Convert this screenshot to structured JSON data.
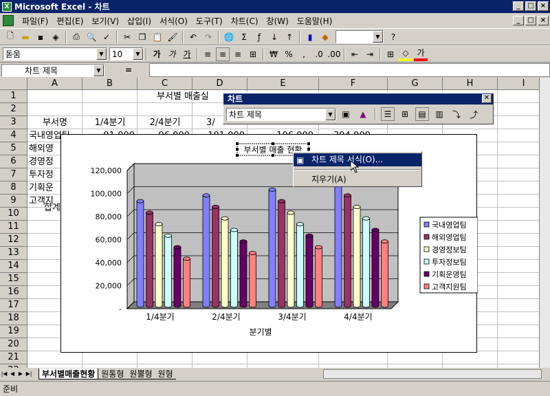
{
  "window": {
    "app_title": "Microsoft Excel - 차트"
  },
  "menu": [
    "파일(F)",
    "편집(E)",
    "보기(V)",
    "삽입(I)",
    "서식(O)",
    "도구(T)",
    "차트(C)",
    "창(W)",
    "도움말(H)"
  ],
  "formatting": {
    "font": "돋움",
    "size": "10",
    "bold": "가",
    "italic": "가",
    "underline": "가"
  },
  "formula_bar": {
    "name_box": "차트 제목",
    "eq": "="
  },
  "columns": [
    "A",
    "B",
    "C",
    "D",
    "E",
    "F",
    "G",
    "H",
    "I"
  ],
  "rows": [
    "1",
    "2",
    "3",
    "4",
    "5",
    "6",
    "7",
    "8",
    "9",
    "10",
    "11",
    "12",
    "13",
    "14",
    "15",
    "16",
    "17",
    "18",
    "19",
    "20",
    "21",
    "22",
    "23"
  ],
  "sheet": {
    "title": "부서별 매출실",
    "headers": [
      "부서명",
      "1/4분기",
      "2/4분기",
      "3/"
    ],
    "dept_col": [
      "국내영업팀",
      "해외영",
      "경영정",
      "투자정",
      "기획운",
      "고객지",
      "합계"
    ],
    "row4": [
      "91,000",
      "96,000",
      "101,000",
      "106,000",
      "394,000"
    ]
  },
  "chart_toolbar": {
    "title": "차트",
    "object_select": "차트 제목",
    "close": "✕"
  },
  "context_menu": {
    "format_title": "차트 제목 서식(O)...",
    "clear": "지우기(A)"
  },
  "chart_data": {
    "type": "bar",
    "title": "부서별 매출 현황",
    "xlabel": "분기별",
    "categories": [
      "1/4분기",
      "2/4분기",
      "3/4분기",
      "4/4분기"
    ],
    "y_ticks": [
      "120,000",
      "100,000",
      "80,000",
      "60,000",
      "40,000",
      "20,000",
      "-"
    ],
    "ylim": [
      0,
      120000
    ],
    "series": [
      {
        "name": "국내영업팀",
        "color": "#8080ff",
        "values": [
          91000,
          96000,
          101000,
          106000
        ]
      },
      {
        "name": "해외영업팀",
        "color": "#993366",
        "values": [
          81000,
          86000,
          91000,
          96000
        ]
      },
      {
        "name": "경영정보팀",
        "color": "#ffffcc",
        "values": [
          71000,
          76000,
          81000,
          86000
        ]
      },
      {
        "name": "투자정보팀",
        "color": "#ccffff",
        "values": [
          61000,
          66000,
          71000,
          76000
        ]
      },
      {
        "name": "기획운영팀",
        "color": "#660066",
        "values": [
          51000,
          56000,
          61000,
          66000
        ]
      },
      {
        "name": "고객지원팀",
        "color": "#ff8080",
        "values": [
          41000,
          46000,
          51000,
          56000
        ]
      }
    ]
  },
  "tabs": [
    "부서별매출현황",
    "원통형",
    "원뿔형",
    "원형"
  ],
  "status": "준비"
}
